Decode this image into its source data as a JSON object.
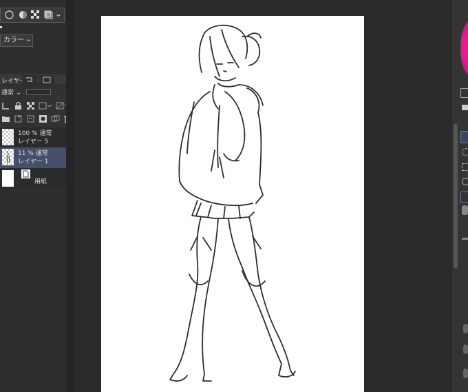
{
  "toolbar": {
    "color_mode_label": "カラー",
    "chevron": "⌄"
  },
  "layer_panel": {
    "tab_label": "レイヤー",
    "blend_mode": "通常",
    "layers": [
      {
        "line1": "100 % 通常",
        "line2": "レイヤー 5",
        "selected": false,
        "thumb": "checker"
      },
      {
        "line1": "11 % 通常",
        "line2": "レイヤー 1",
        "selected": true,
        "thumb": "checker-sketch"
      },
      {
        "line1": "",
        "line2": "用紙",
        "selected": false,
        "thumb": "white"
      }
    ]
  },
  "colors": {
    "accent": "#3d4656",
    "selected_row": "#44506a",
    "color_wheel": "#e8168f"
  },
  "icons": [
    "circle-icon",
    "half-circle-icon",
    "checker-icon",
    "layer-stack-icon",
    "lock-icon",
    "clip-icon",
    "mask-icon",
    "trash-icon",
    "folder-icon",
    "paper-icon"
  ]
}
